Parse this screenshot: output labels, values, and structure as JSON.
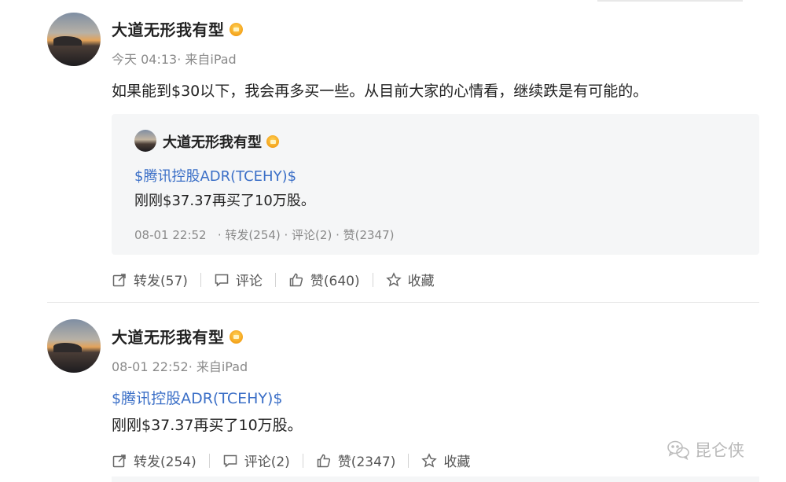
{
  "post1": {
    "author": "大道无形我有型",
    "meta": "今天 04:13· 来自iPad",
    "text": "如果能到$30以下，我会再多买一些。从目前大家的心情看，继续跌是有可能的。",
    "quote": {
      "author": "大道无形我有型",
      "topic": "$腾讯控股ADR(TCEHY)$",
      "body": "刚刚$37.37再买了10万股。",
      "footer": "08-01 22:52   · 转发(254) · 评论(2) · 赞(2347)"
    },
    "actions": {
      "repost": "转发(57)",
      "comment": "评论",
      "like": "赞(640)",
      "favorite": "收藏"
    }
  },
  "post2": {
    "author": "大道无形我有型",
    "meta": "08-01 22:52· 来自iPad",
    "topic": "$腾讯控股ADR(TCEHY)$",
    "body": "刚刚$37.37再买了10万股。",
    "actions": {
      "repost": "转发(254)",
      "comment": "评论(2)",
      "like": "赞(2347)",
      "favorite": "收藏"
    }
  },
  "watermark": "昆仑侠",
  "icons": {
    "repost": "share-icon",
    "comment": "comment-icon",
    "like": "thumbs-up-icon",
    "favorite": "star-icon",
    "verified": "verified-badge-icon",
    "wechat": "wechat-icon"
  },
  "colors": {
    "link": "#3b6fc7",
    "meta": "#8a8a8a",
    "quote_bg": "#f5f6f7",
    "badge": "#f4a21a"
  }
}
